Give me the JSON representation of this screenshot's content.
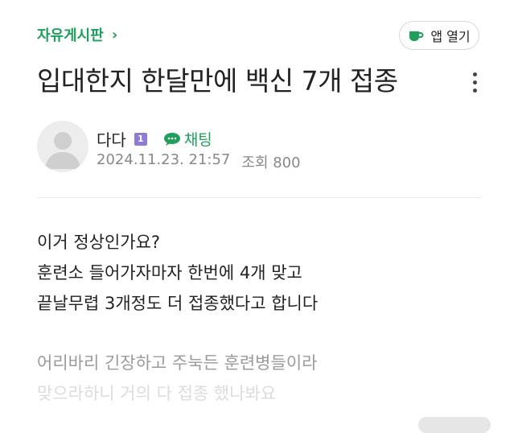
{
  "header": {
    "board_name": "자유게시판",
    "board_chevron": "›",
    "app_button_label": "앱 열기"
  },
  "post": {
    "title": "입대한지 한달만에 백신 7개 접종",
    "author": "다다",
    "grade_badge": "1",
    "chat_label": "채팅",
    "date": "2024.11.23. 21:57",
    "views": "조회 800",
    "body": [
      "이거 정상인가요?",
      "훈련소 들어가자마자 한번에 4개 맞고",
      "끝날무렵 3개정도 더 접종했다고 합니다"
    ],
    "body_faded": [
      "어리바리 긴장하고 주눅든 훈련병들이라",
      "맞으라하니 거의 다 접종 했나봐요"
    ]
  },
  "colors": {
    "accent": "#1fa05a",
    "grade_badge": "#8f7bd6",
    "meta_text": "#888888"
  },
  "icons": {
    "app": "cafe-cup-icon",
    "chat": "chat-bubble-icon",
    "more": "more-vertical-icon",
    "avatar": "default-avatar-icon"
  }
}
